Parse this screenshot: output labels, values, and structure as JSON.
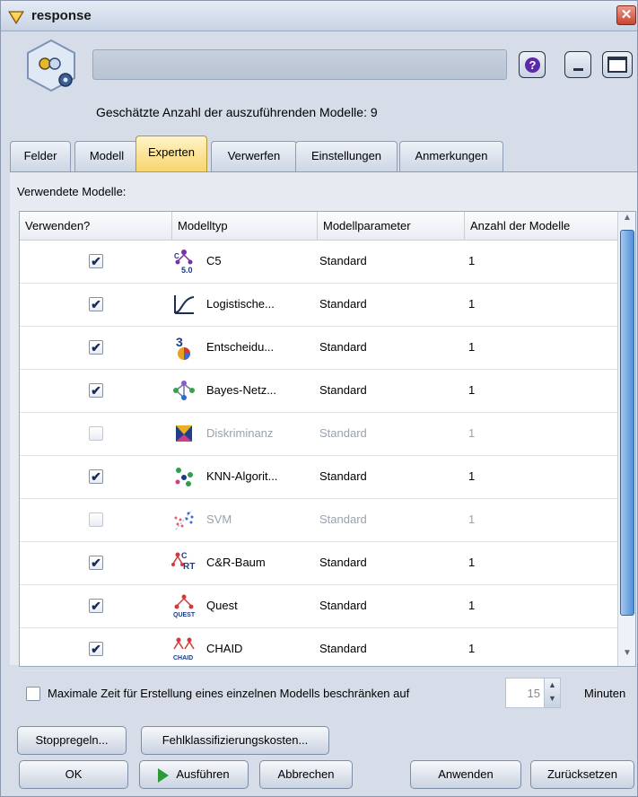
{
  "window": {
    "title": "response",
    "close_glyph": "✕",
    "help_glyph": "?",
    "estimate_text": "Geschätzte Anzahl der auszuführenden Modelle: 9"
  },
  "tabs": [
    {
      "label": "Felder"
    },
    {
      "label": "Modell"
    },
    {
      "label": "Experten",
      "active": true
    },
    {
      "label": "Verwerfen"
    },
    {
      "label": "Einstellungen"
    },
    {
      "label": "Anmerkungen"
    }
  ],
  "panel": {
    "label": "Verwendete Modelle:",
    "columns": [
      "Verwenden?",
      "Modelltyp",
      "Modellparameter",
      "Anzahl der Modelle"
    ],
    "rows": [
      {
        "checked": true,
        "icon": "c50-icon",
        "icon_text": "C5.0",
        "type": "C5",
        "param": "Standard",
        "count": "1"
      },
      {
        "checked": true,
        "icon": "logistic-icon",
        "icon_text": "",
        "type": "Logistische...",
        "param": "Standard",
        "count": "1"
      },
      {
        "checked": true,
        "icon": "decision-list-icon",
        "icon_text": "",
        "type": "Entscheidu...",
        "param": "Standard",
        "count": "1"
      },
      {
        "checked": true,
        "icon": "bayes-net-icon",
        "icon_text": "",
        "type": "Bayes-Netz...",
        "param": "Standard",
        "count": "1"
      },
      {
        "checked": false,
        "icon": "discriminant-icon",
        "icon_text": "",
        "type": "Diskriminanz",
        "param": "Standard",
        "count": "1"
      },
      {
        "checked": true,
        "icon": "knn-icon",
        "icon_text": "",
        "type": "KNN-Algorit...",
        "param": "Standard",
        "count": "1"
      },
      {
        "checked": false,
        "icon": "svm-icon",
        "icon_text": "",
        "type": "SVM",
        "param": "Standard",
        "count": "1"
      },
      {
        "checked": true,
        "icon": "crt-icon",
        "icon_text": "C RT",
        "type": "C&R-Baum",
        "param": "Standard",
        "count": "1"
      },
      {
        "checked": true,
        "icon": "quest-icon",
        "icon_text": "QUEST",
        "type": "Quest",
        "param": "Standard",
        "count": "1"
      },
      {
        "checked": true,
        "icon": "chaid-icon",
        "icon_text": "CHAID",
        "type": "CHAID",
        "param": "Standard",
        "count": "1"
      }
    ]
  },
  "limit": {
    "label": "Maximale Zeit für Erstellung eines einzelnen Modells beschränken auf",
    "value": "15",
    "unit": "Minuten",
    "checked": false
  },
  "buttons": {
    "stop_rules": "Stoppregeln...",
    "misclass_costs": "Fehlklassifizierungskosten...",
    "ok": "OK",
    "run": "Ausführen",
    "cancel": "Abbrechen",
    "apply": "Anwenden",
    "reset": "Zurücksetzen"
  },
  "colors": {
    "active_tab": "#f7d56a",
    "checkmark": "#1d2a5e",
    "run_icon": "#2c9a36",
    "help_icon": "#5b2aa6",
    "close_button": "#c9452f"
  }
}
